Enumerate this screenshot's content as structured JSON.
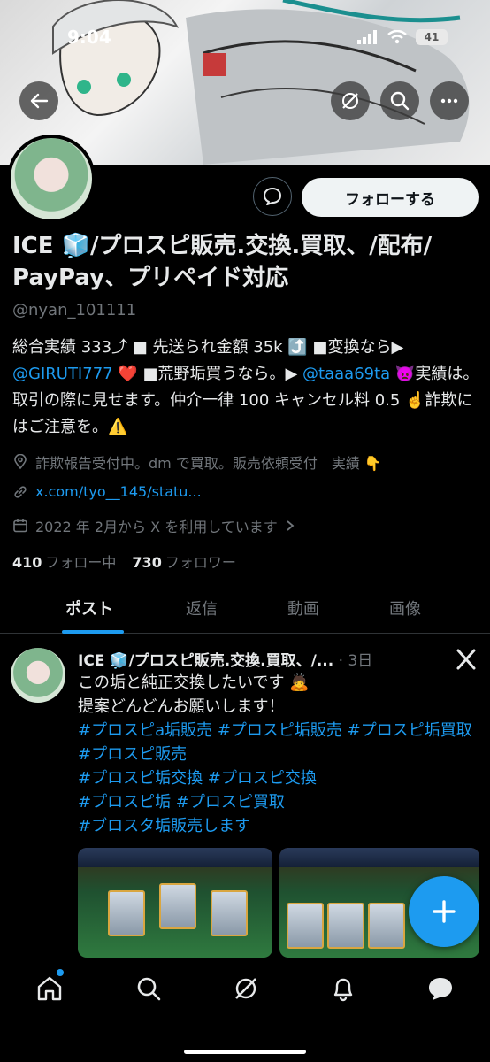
{
  "status_bar": {
    "time": "9:04",
    "battery": "41"
  },
  "profile": {
    "display_name": "ICE 🧊/プロスピ販売.交換.買取、/配布/ PayPay、プリペイド対応",
    "handle": "@nyan_101111",
    "bio": {
      "part1": "総合実績 333⤴︎ ■ 先送られ金額 35k ⤴️ ■変換なら▶︎",
      "mention1": "@GIRUTI777",
      "part2": " ❤️ ■荒野垢買うなら。▶︎ ",
      "mention2": "@taaa69ta",
      "part3": " 👿実績は。取引の際に見せます。仲介一律 100 キャンセル料 0.5 ☝️詐欺にはご注意を。⚠️"
    },
    "location": "詐欺報告受付中。dm で買取。販売依頼受付　実績 👇",
    "link": "x.com/tyo__145/statu...",
    "joined": "2022 年 2月から X を利用しています",
    "following_count": "410",
    "following_label": "フォロー中",
    "followers_count": "730",
    "followers_label": "フォロワー",
    "follow_button": "フォローする"
  },
  "tabs": [
    {
      "label": "ポスト",
      "active": true
    },
    {
      "label": "返信",
      "active": false
    },
    {
      "label": "動画",
      "active": false
    },
    {
      "label": "画像",
      "active": false
    }
  ],
  "post": {
    "author": "ICE 🧊/プロスピ販売.交換.買取、/...",
    "time": "3日",
    "line1": "この垢と純正交換したいです 🙇",
    "line2": "提案どんどんお願いします！",
    "hashtags1": "#プロスピa垢販売 #プロスピ垢販売 #プロスピ垢買取 #プロスピ販売",
    "hashtags2": "#プロスピ垢交換 #プロスピ交換",
    "hashtags3": "#プロスピ垢 #プロスピ買取",
    "hashtags4": "#ブロスタ垢販売します"
  },
  "colors": {
    "accent": "#1d9bf0",
    "text": "#e7e9ea",
    "muted": "#71767b",
    "background": "#000000"
  }
}
